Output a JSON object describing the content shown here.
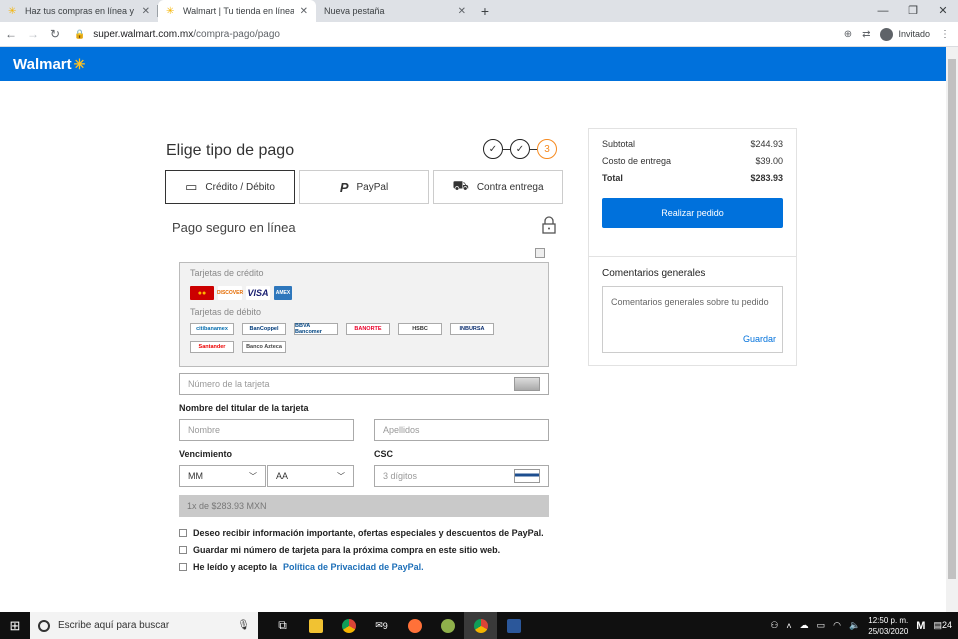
{
  "browser": {
    "tabs": [
      {
        "title": "Haz tus compras en línea y super",
        "active": false
      },
      {
        "title": "Walmart | Tu tienda en línea",
        "active": true
      },
      {
        "title": "Nueva pestaña",
        "active": false
      }
    ],
    "url_host": "super.walmart.com.mx",
    "url_path": "/compra-pago/pago",
    "profile": "Invitado"
  },
  "header": {
    "logo": "Walmart"
  },
  "checkout": {
    "title": "Elige tipo de pago",
    "step_current": "3",
    "methods": [
      {
        "label": "Crédito / Débito",
        "icon": "credit-card-icon"
      },
      {
        "label": "PayPal",
        "icon": "paypal-icon"
      },
      {
        "label": "Contra entrega",
        "icon": "cash-on-delivery-icon"
      }
    ],
    "secure_label": "Pago seguro en línea",
    "credit_label": "Tarjetas de crédito",
    "debit_label": "Tarjetas de débito",
    "credit_brands": [
      "MasterCard",
      "Discover",
      "VISA",
      "AMEX"
    ],
    "debit_brands": [
      "citibanamex",
      "BanCoppel",
      "BBVA Bancomer",
      "BANORTE",
      "HSBC",
      "INBURSA",
      "Santander",
      "Banco Azteca"
    ],
    "card_number_placeholder": "Número de la tarjeta",
    "holder_label": "Nombre del titular de la tarjeta",
    "first_name_placeholder": "Nombre",
    "last_name_placeholder": "Apellidos",
    "expiry_label": "Vencimiento",
    "month_value": "MM",
    "year_value": "AA",
    "csc_label": "CSC",
    "csc_placeholder": "3 dígitos",
    "installments": "1x de $283.93 MXN",
    "checkbox_1": "Deseo recibir información importante, ofertas especiales y descuentos de PayPal.",
    "checkbox_2": "Guardar mi número de tarjeta para la próxima compra en este sitio web.",
    "checkbox_3_prefix": "He leído y acepto la",
    "checkbox_3_link": "Política de Privacidad de PayPal."
  },
  "summary": {
    "subtotal_label": "Subtotal",
    "subtotal_value": "$244.93",
    "delivery_label": "Costo de entrega",
    "delivery_value": "$39.00",
    "total_label": "Total",
    "total_value": "$283.93",
    "order_button": "Realizar pedido",
    "comments_title": "Comentarios generales",
    "comments_placeholder": "Comentarios generales sobre tu pedido",
    "save_label": "Guardar"
  },
  "taskbar": {
    "search_placeholder": "Escribe aquí para buscar",
    "time": "12:50 p. m.",
    "date": "25/03/2020",
    "notif_count": "24",
    "mail_badge": "9"
  }
}
